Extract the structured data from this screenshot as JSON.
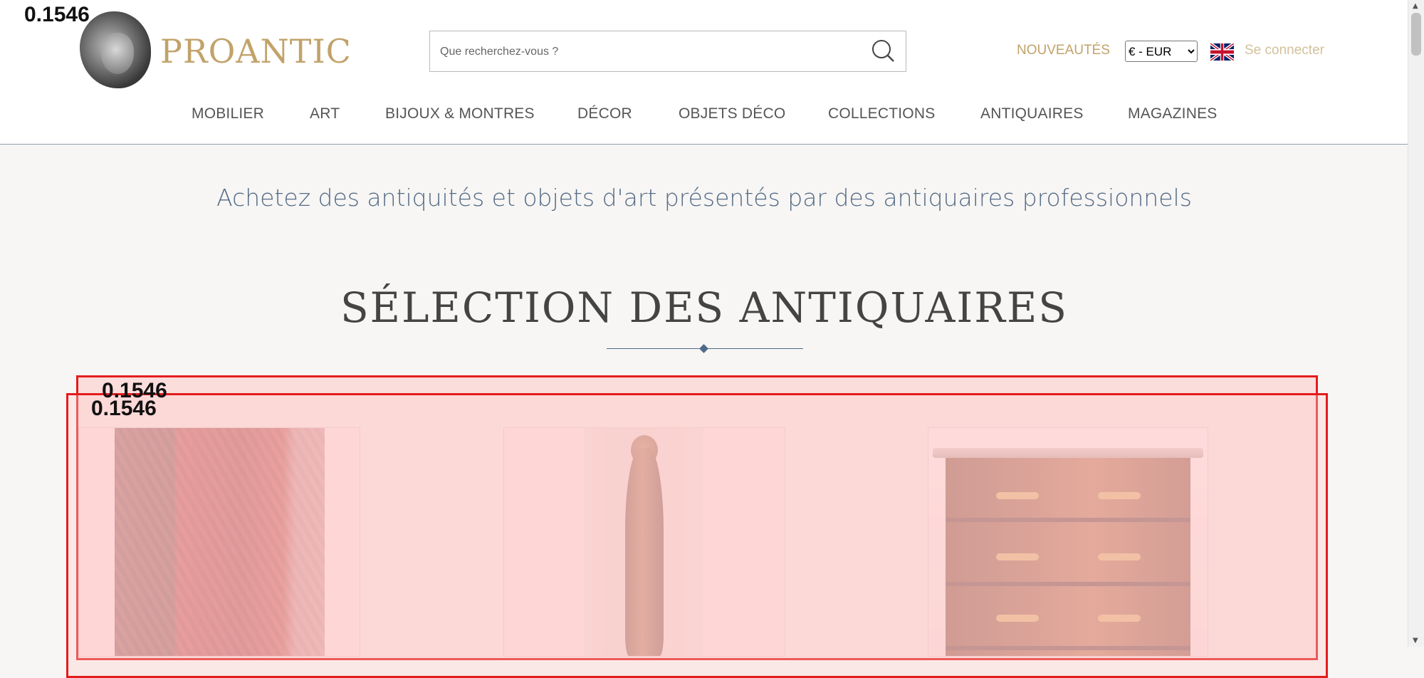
{
  "brand": {
    "name": "PROANTIC",
    "logo_icon": "classical-head-icon"
  },
  "search": {
    "placeholder": "Que recherchez-vous ?",
    "icon": "search-icon"
  },
  "header": {
    "new_label": "NOUVEAUTÉS",
    "currency": {
      "selected": "€ - EUR"
    },
    "language_icon": "uk-flag-icon",
    "login_label": "Se connecter"
  },
  "nav": {
    "items": [
      {
        "label": "MOBILIER"
      },
      {
        "label": "ART"
      },
      {
        "label": "BIJOUX & MONTRES"
      },
      {
        "label": "DÉCOR"
      },
      {
        "label": "OBJETS DÉCO"
      },
      {
        "label": "COLLECTIONS"
      },
      {
        "label": "ANTIQUAIRES"
      },
      {
        "label": "MAGAZINES"
      }
    ]
  },
  "main": {
    "tagline": "Achetez des antiquités et objets d'art présentés par des antiquaires professionnels",
    "section_title": "SÉLECTION DES ANTIQUAIRES"
  },
  "overlays": {
    "scores": [
      "0.1546",
      "0.1546",
      "0.1546"
    ],
    "color": "#e31c1c"
  },
  "products": [
    {
      "image": "red-paisley-shawl-photo"
    },
    {
      "image": "bronze-statue-photo"
    },
    {
      "image": "marquetry-commode-photo"
    }
  ],
  "colors": {
    "accent_gold": "#c1a36a",
    "text_blue": "#546b86",
    "background": "#f7f6f4"
  }
}
